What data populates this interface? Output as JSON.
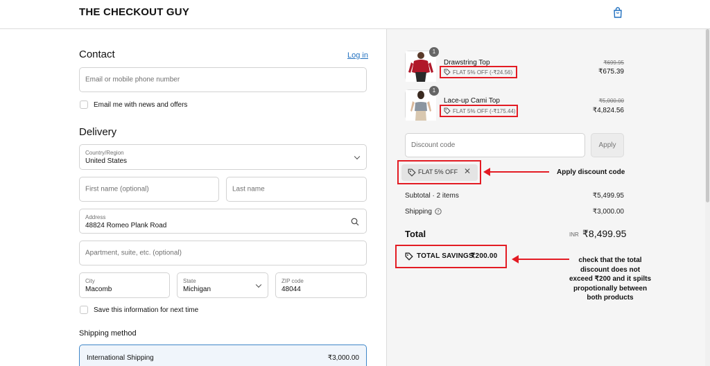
{
  "header": {
    "brand": "THE CHECKOUT GUY",
    "cart_icon": "shopping-bag-icon"
  },
  "contact": {
    "title": "Contact",
    "login_link": "Log in",
    "email_placeholder": "Email or mobile phone number",
    "news_label": "Email me with news and offers"
  },
  "delivery": {
    "title": "Delivery",
    "country_label": "Country/Region",
    "country_value": "United States",
    "first_name_placeholder": "First name (optional)",
    "last_name_placeholder": "Last name",
    "address_label": "Address",
    "address_value": "48824 Romeo Plank Road",
    "apartment_placeholder": "Apartment, suite, etc. (optional)",
    "city_label": "City",
    "city_value": "Macomb",
    "state_label": "State",
    "state_value": "Michigan",
    "zip_label": "ZIP code",
    "zip_value": "48044",
    "save_label": "Save this information for next time"
  },
  "shipping_method": {
    "title": "Shipping method",
    "option_name": "International Shipping",
    "option_price": "₹3,000.00"
  },
  "cart": {
    "items": [
      {
        "name": "Drawstring Top",
        "qty": "1",
        "discount": "FLAT 5% OFF (-₹24.56)",
        "old_price": "₹699.95",
        "price": "₹675.39"
      },
      {
        "name": "Lace-up Cami Top",
        "qty": "1",
        "discount": "FLAT 5% OFF (-₹175.44)",
        "old_price": "₹5,000.00",
        "price": "₹4,824.56"
      }
    ],
    "discount_placeholder": "Discount code",
    "apply_label": "Apply",
    "applied_code": "FLAT 5% OFF",
    "subtotal_label": "Subtotal · 2 items",
    "subtotal_value": "₹5,499.95",
    "shipping_label": "Shipping",
    "shipping_value": "₹3,000.00",
    "total_label": "Total",
    "total_currency": "INR",
    "total_value": "₹8,499.95",
    "savings_label": "TOTAL SAVINGS",
    "savings_value": "₹200.00"
  },
  "annotations": {
    "apply_note": "Apply discount code",
    "check_note_lines": [
      "check that the total",
      "discount does not",
      "exceed ₹200 and it spilts",
      "propotionally between",
      "both products"
    ]
  },
  "colors": {
    "annotation_red": "#e31b23",
    "link_blue": "#1f6fbf",
    "summary_bg": "#f5f5f5"
  }
}
